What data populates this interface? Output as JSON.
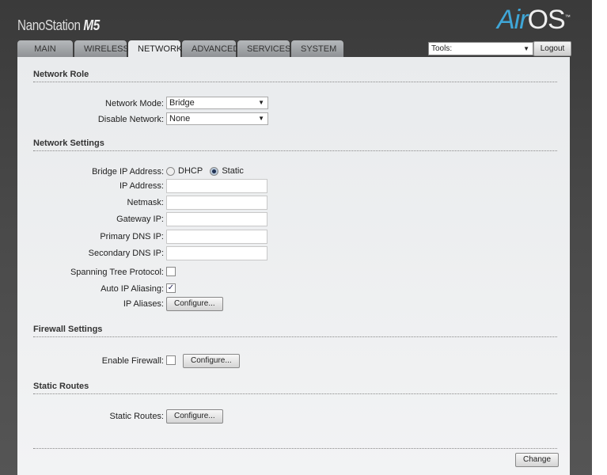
{
  "header": {
    "brand": "NanoStation",
    "model": "M5",
    "logo_air": "Air",
    "logo_os": "OS",
    "logo_tm": "™"
  },
  "tabs": [
    {
      "label": "MAIN"
    },
    {
      "label": "WIRELESS"
    },
    {
      "label": "NETWORK",
      "active": true
    },
    {
      "label": "ADVANCED"
    },
    {
      "label": "SERVICES"
    },
    {
      "label": "SYSTEM"
    }
  ],
  "tools": {
    "value": "Tools:",
    "logout": "Logout"
  },
  "network_role": {
    "title": "Network Role",
    "mode_label": "Network Mode:",
    "mode_value": "Bridge",
    "disable_label": "Disable Network:",
    "disable_value": "None"
  },
  "network_settings": {
    "title": "Network Settings",
    "bridge_ip_label": "Bridge IP Address:",
    "dhcp": "DHCP",
    "static": "Static",
    "selected": "Static",
    "ip_label": "IP Address:",
    "ip_value": "",
    "netmask_label": "Netmask:",
    "netmask_value": "",
    "gateway_label": "Gateway IP:",
    "gateway_value": "",
    "dns1_label": "Primary DNS IP:",
    "dns1_value": "",
    "dns2_label": "Secondary DNS IP:",
    "dns2_value": "",
    "stp_label": "Spanning Tree Protocol:",
    "stp_checked": false,
    "alias_label": "Auto IP Aliasing:",
    "alias_checked": true,
    "aliases_label": "IP Aliases:",
    "configure": "Configure..."
  },
  "firewall": {
    "title": "Firewall Settings",
    "enable_label": "Enable Firewall:",
    "enabled": false,
    "configure": "Configure..."
  },
  "routes": {
    "title": "Static Routes",
    "label": "Static Routes:",
    "configure": "Configure..."
  },
  "change": "Change"
}
